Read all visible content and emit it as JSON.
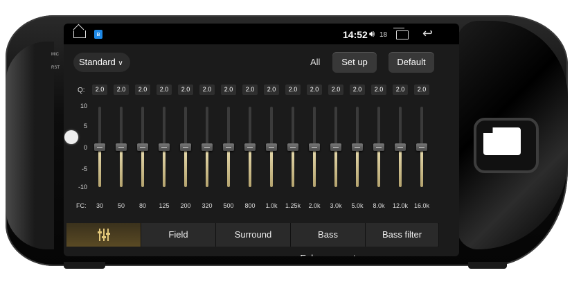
{
  "device": {
    "mic_label": "MIC",
    "rst_label": "RST"
  },
  "status": {
    "time": "14:52",
    "volume": "18",
    "bt_glyph": "ʙ"
  },
  "toolbar": {
    "preset": "Standard",
    "all_label": "All",
    "setup_label": "Set up",
    "default_label": "Default"
  },
  "eq": {
    "q_label": "Q:",
    "fc_label": "FC:",
    "q_values": [
      "2.0",
      "2.0",
      "2.0",
      "2.0",
      "2.0",
      "2.0",
      "2.0",
      "2.0",
      "2.0",
      "2.0",
      "2.0",
      "2.0",
      "2.0",
      "2.0",
      "2.0",
      "2.0"
    ],
    "scale_labels": [
      "10",
      "5",
      "0",
      "-5",
      "-10"
    ],
    "bands": [
      "30",
      "50",
      "80",
      "125",
      "200",
      "320",
      "500",
      "800",
      "1.0k",
      "1.25k",
      "2.0k",
      "3.0k",
      "5.0k",
      "8.0k",
      "12.0k",
      "16.0k"
    ],
    "gains": [
      0,
      0,
      0,
      0,
      0,
      0,
      0,
      0,
      0,
      0,
      0,
      0,
      0,
      0,
      0,
      0
    ],
    "range": [
      -10,
      10
    ]
  },
  "tabs": [
    {
      "label": "",
      "icon": "equalizer-icon",
      "active": true
    },
    {
      "label": "Field",
      "active": false
    },
    {
      "label": "Surround",
      "active": false
    },
    {
      "label": "Bass Enhancement",
      "active": false
    },
    {
      "label": "Bass filter",
      "active": false
    }
  ],
  "colors": {
    "accent": "#e3c77a",
    "fill_top": "#e8dcb0",
    "panel": "#1b1b1b"
  }
}
